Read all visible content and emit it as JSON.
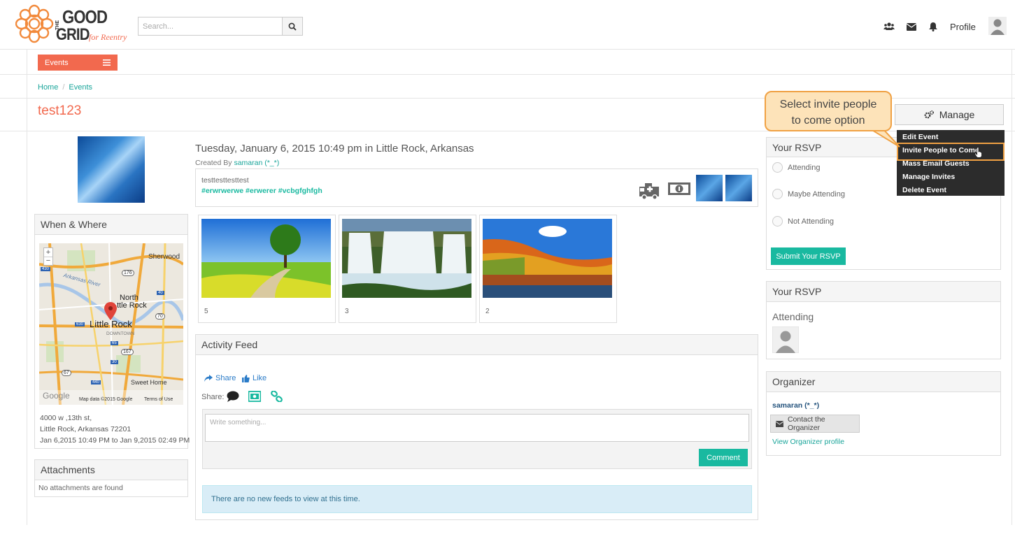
{
  "brand": {
    "line1": "THE",
    "line2": "GOOD",
    "line3": "GRID",
    "tagline": "for Reentry",
    "colors": {
      "accent": "#f2694e",
      "teal": "#1aa59a",
      "button_teal": "#19b9a0"
    }
  },
  "header": {
    "search_placeholder": "Search...",
    "icons": [
      "users-icon",
      "envelope-icon",
      "bell-icon"
    ],
    "profile_label": "Profile"
  },
  "nav": {
    "events_label": "Events"
  },
  "breadcrumb": {
    "home": "Home",
    "sep": "/",
    "current": "Events"
  },
  "event": {
    "title": "test123",
    "datetime": "Tuesday, January 6, 2015 10:49 pm in Little Rock, Arkansas",
    "created_by_label": "Created By",
    "creator": "samaran (*_*)",
    "description": "testtesttesttest",
    "hashtags": "#erwrwerwe #erwerer #vcbgfghfgh"
  },
  "when_where": {
    "heading": "When & Where",
    "map": {
      "places": [
        "Sherwood",
        "North",
        "ttle Rock",
        "Little Rock",
        "DOWNTOWN",
        "Arkansas River",
        "Sweet Home",
        "Google"
      ],
      "shields": [
        "430",
        "176",
        "40",
        "70",
        "630",
        "167",
        "30",
        "67",
        "440",
        "65"
      ],
      "attribution": "Map data ©2015 Google",
      "terms": "Terms of Use",
      "zoom_in": "+",
      "zoom_out": "−"
    },
    "address_line1": "4000 w ,13th st,",
    "address_line2": "Little Rock, Arkansas 72201",
    "date_range": "Jan 6,2015 10:49 PM to Jan 9,2015 02:49 PM"
  },
  "attachments": {
    "heading": "Attachments",
    "empty": "No attachments are found"
  },
  "gallery": [
    {
      "count": "5",
      "scene": "tree-road"
    },
    {
      "count": "3",
      "scene": "waterfall"
    },
    {
      "count": "2",
      "scene": "autumn-lake"
    }
  ],
  "activity_feed": {
    "heading": "Activity Feed",
    "share": "Share",
    "like": "Like",
    "share_label": "Share:",
    "placeholder": "Write something...",
    "comment_button": "Comment",
    "empty": "There are no new feeds to view at this time."
  },
  "manage": {
    "label": "Manage",
    "menu": [
      "Edit Event",
      "Invite People to Come",
      "Mass Email Guests",
      "Manage Invites",
      "Delete Event"
    ]
  },
  "callout": {
    "line1": "Select invite people",
    "line2": "to come option"
  },
  "rsvp": {
    "heading": "Your RSVP",
    "options": [
      "Attending",
      "Maybe Attending",
      "Not Attending"
    ],
    "submit": "Submit Your RSVP"
  },
  "rsvp_status": {
    "heading": "Your RSVP",
    "status": "Attending"
  },
  "organizer": {
    "heading": "Organizer",
    "name": "samaran (*_*)",
    "contact_button": "Contact the Organizer",
    "profile_link": "View Organizer profile"
  }
}
